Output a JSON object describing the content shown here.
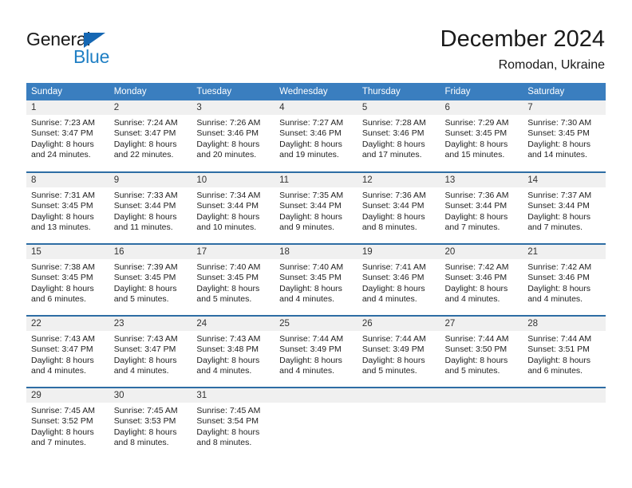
{
  "brand": {
    "name_part1": "General",
    "name_part2": "Blue",
    "triangle_color": "#1567b3",
    "blue_text_color": "#1f7fc4"
  },
  "header": {
    "title": "December 2024",
    "subtitle": "Romodan, Ukraine"
  },
  "colors": {
    "header_band": "#3a7ebf",
    "row_divider": "#2e6da4",
    "daynum_band": "#f0f0f0",
    "text": "#222222"
  },
  "weekday_headers": [
    "Sunday",
    "Monday",
    "Tuesday",
    "Wednesday",
    "Thursday",
    "Friday",
    "Saturday"
  ],
  "weeks": [
    [
      {
        "day": "1",
        "sunrise": "Sunrise: 7:23 AM",
        "sunset": "Sunset: 3:47 PM",
        "daylight1": "Daylight: 8 hours",
        "daylight2": "and 24 minutes."
      },
      {
        "day": "2",
        "sunrise": "Sunrise: 7:24 AM",
        "sunset": "Sunset: 3:47 PM",
        "daylight1": "Daylight: 8 hours",
        "daylight2": "and 22 minutes."
      },
      {
        "day": "3",
        "sunrise": "Sunrise: 7:26 AM",
        "sunset": "Sunset: 3:46 PM",
        "daylight1": "Daylight: 8 hours",
        "daylight2": "and 20 minutes."
      },
      {
        "day": "4",
        "sunrise": "Sunrise: 7:27 AM",
        "sunset": "Sunset: 3:46 PM",
        "daylight1": "Daylight: 8 hours",
        "daylight2": "and 19 minutes."
      },
      {
        "day": "5",
        "sunrise": "Sunrise: 7:28 AM",
        "sunset": "Sunset: 3:46 PM",
        "daylight1": "Daylight: 8 hours",
        "daylight2": "and 17 minutes."
      },
      {
        "day": "6",
        "sunrise": "Sunrise: 7:29 AM",
        "sunset": "Sunset: 3:45 PM",
        "daylight1": "Daylight: 8 hours",
        "daylight2": "and 15 minutes."
      },
      {
        "day": "7",
        "sunrise": "Sunrise: 7:30 AM",
        "sunset": "Sunset: 3:45 PM",
        "daylight1": "Daylight: 8 hours",
        "daylight2": "and 14 minutes."
      }
    ],
    [
      {
        "day": "8",
        "sunrise": "Sunrise: 7:31 AM",
        "sunset": "Sunset: 3:45 PM",
        "daylight1": "Daylight: 8 hours",
        "daylight2": "and 13 minutes."
      },
      {
        "day": "9",
        "sunrise": "Sunrise: 7:33 AM",
        "sunset": "Sunset: 3:44 PM",
        "daylight1": "Daylight: 8 hours",
        "daylight2": "and 11 minutes."
      },
      {
        "day": "10",
        "sunrise": "Sunrise: 7:34 AM",
        "sunset": "Sunset: 3:44 PM",
        "daylight1": "Daylight: 8 hours",
        "daylight2": "and 10 minutes."
      },
      {
        "day": "11",
        "sunrise": "Sunrise: 7:35 AM",
        "sunset": "Sunset: 3:44 PM",
        "daylight1": "Daylight: 8 hours",
        "daylight2": "and 9 minutes."
      },
      {
        "day": "12",
        "sunrise": "Sunrise: 7:36 AM",
        "sunset": "Sunset: 3:44 PM",
        "daylight1": "Daylight: 8 hours",
        "daylight2": "and 8 minutes."
      },
      {
        "day": "13",
        "sunrise": "Sunrise: 7:36 AM",
        "sunset": "Sunset: 3:44 PM",
        "daylight1": "Daylight: 8 hours",
        "daylight2": "and 7 minutes."
      },
      {
        "day": "14",
        "sunrise": "Sunrise: 7:37 AM",
        "sunset": "Sunset: 3:44 PM",
        "daylight1": "Daylight: 8 hours",
        "daylight2": "and 7 minutes."
      }
    ],
    [
      {
        "day": "15",
        "sunrise": "Sunrise: 7:38 AM",
        "sunset": "Sunset: 3:45 PM",
        "daylight1": "Daylight: 8 hours",
        "daylight2": "and 6 minutes."
      },
      {
        "day": "16",
        "sunrise": "Sunrise: 7:39 AM",
        "sunset": "Sunset: 3:45 PM",
        "daylight1": "Daylight: 8 hours",
        "daylight2": "and 5 minutes."
      },
      {
        "day": "17",
        "sunrise": "Sunrise: 7:40 AM",
        "sunset": "Sunset: 3:45 PM",
        "daylight1": "Daylight: 8 hours",
        "daylight2": "and 5 minutes."
      },
      {
        "day": "18",
        "sunrise": "Sunrise: 7:40 AM",
        "sunset": "Sunset: 3:45 PM",
        "daylight1": "Daylight: 8 hours",
        "daylight2": "and 4 minutes."
      },
      {
        "day": "19",
        "sunrise": "Sunrise: 7:41 AM",
        "sunset": "Sunset: 3:46 PM",
        "daylight1": "Daylight: 8 hours",
        "daylight2": "and 4 minutes."
      },
      {
        "day": "20",
        "sunrise": "Sunrise: 7:42 AM",
        "sunset": "Sunset: 3:46 PM",
        "daylight1": "Daylight: 8 hours",
        "daylight2": "and 4 minutes."
      },
      {
        "day": "21",
        "sunrise": "Sunrise: 7:42 AM",
        "sunset": "Sunset: 3:46 PM",
        "daylight1": "Daylight: 8 hours",
        "daylight2": "and 4 minutes."
      }
    ],
    [
      {
        "day": "22",
        "sunrise": "Sunrise: 7:43 AM",
        "sunset": "Sunset: 3:47 PM",
        "daylight1": "Daylight: 8 hours",
        "daylight2": "and 4 minutes."
      },
      {
        "day": "23",
        "sunrise": "Sunrise: 7:43 AM",
        "sunset": "Sunset: 3:47 PM",
        "daylight1": "Daylight: 8 hours",
        "daylight2": "and 4 minutes."
      },
      {
        "day": "24",
        "sunrise": "Sunrise: 7:43 AM",
        "sunset": "Sunset: 3:48 PM",
        "daylight1": "Daylight: 8 hours",
        "daylight2": "and 4 minutes."
      },
      {
        "day": "25",
        "sunrise": "Sunrise: 7:44 AM",
        "sunset": "Sunset: 3:49 PM",
        "daylight1": "Daylight: 8 hours",
        "daylight2": "and 4 minutes."
      },
      {
        "day": "26",
        "sunrise": "Sunrise: 7:44 AM",
        "sunset": "Sunset: 3:49 PM",
        "daylight1": "Daylight: 8 hours",
        "daylight2": "and 5 minutes."
      },
      {
        "day": "27",
        "sunrise": "Sunrise: 7:44 AM",
        "sunset": "Sunset: 3:50 PM",
        "daylight1": "Daylight: 8 hours",
        "daylight2": "and 5 minutes."
      },
      {
        "day": "28",
        "sunrise": "Sunrise: 7:44 AM",
        "sunset": "Sunset: 3:51 PM",
        "daylight1": "Daylight: 8 hours",
        "daylight2": "and 6 minutes."
      }
    ],
    [
      {
        "day": "29",
        "sunrise": "Sunrise: 7:45 AM",
        "sunset": "Sunset: 3:52 PM",
        "daylight1": "Daylight: 8 hours",
        "daylight2": "and 7 minutes."
      },
      {
        "day": "30",
        "sunrise": "Sunrise: 7:45 AM",
        "sunset": "Sunset: 3:53 PM",
        "daylight1": "Daylight: 8 hours",
        "daylight2": "and 8 minutes."
      },
      {
        "day": "31",
        "sunrise": "Sunrise: 7:45 AM",
        "sunset": "Sunset: 3:54 PM",
        "daylight1": "Daylight: 8 hours",
        "daylight2": "and 8 minutes."
      },
      {
        "day": "",
        "sunrise": "",
        "sunset": "",
        "daylight1": "",
        "daylight2": ""
      },
      {
        "day": "",
        "sunrise": "",
        "sunset": "",
        "daylight1": "",
        "daylight2": ""
      },
      {
        "day": "",
        "sunrise": "",
        "sunset": "",
        "daylight1": "",
        "daylight2": ""
      },
      {
        "day": "",
        "sunrise": "",
        "sunset": "",
        "daylight1": "",
        "daylight2": ""
      }
    ]
  ]
}
